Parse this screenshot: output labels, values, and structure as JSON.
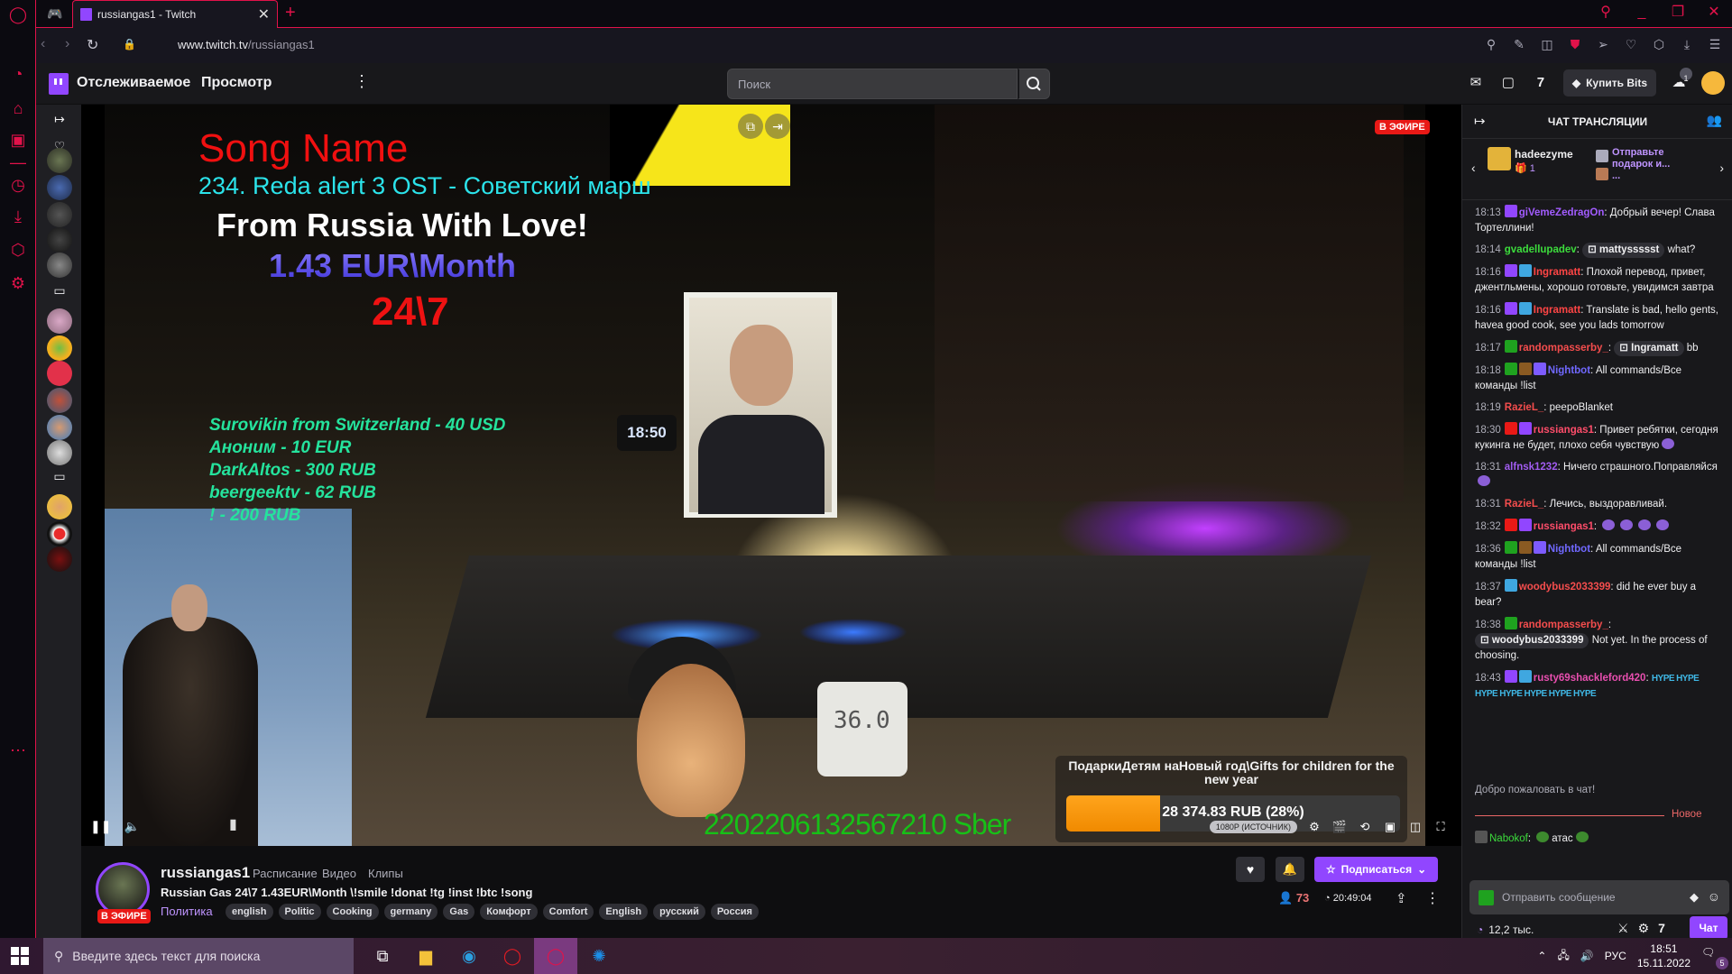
{
  "browser": {
    "tab_title": "russiangas1 - Twitch",
    "url_domain": "www.twitch.tv",
    "url_path": "/russiangas1",
    "accent": "#e2124a"
  },
  "twitch_nav": {
    "following": "Отслеживаемое",
    "browse": "Просмотр",
    "search_placeholder": "Поиск",
    "bits_button": "Купить Bits",
    "notification_count": "1",
    "brand_color": "#9146ff"
  },
  "video": {
    "live_badge": "В ЭФИРЕ",
    "overlay": {
      "song_label": "Song Name",
      "track": "234. Reda alert 3 OST - Советский марш",
      "slogan": "From Russia With Love!",
      "price": "1.43 EUR\\Month",
      "schedule": "24\\7",
      "donations": [
        "Surovikin from Switzerland - 40 USD",
        "Аноним - 10 EUR",
        "DarkAltos - 300 RUB",
        "beergeektv - 62 RUB",
        "! - 200 RUB"
      ],
      "bank": "2202206132567210 Sber",
      "clock": "18:50",
      "thermometer": "36.0"
    },
    "goal": {
      "title": "ПодаркиДетям наНовый год\\Gifts for children for the new year",
      "amount": "28 374.83 RUB (28%)",
      "progress_percent": 28
    },
    "quality": "1080P (ИСТОЧНИК)"
  },
  "channel": {
    "name": "russiangas1",
    "live_badge": "В ЭФИРЕ",
    "links": [
      "Расписание",
      "Видео",
      "Клипы"
    ],
    "title": "Russian Gas 24\\7 1.43EUR\\Month \\!smile !donat !tg !inst !btc !song",
    "category": "Политика",
    "tags": [
      "english",
      "Politic",
      "Cooking",
      "germany",
      "Gas",
      "Комфорт",
      "Comfort",
      "English",
      "русский",
      "Россия"
    ],
    "subscribe_label": "Подписаться",
    "viewers": "73",
    "uptime": "20:49:04"
  },
  "chat": {
    "header": "ЧАТ ТРАНСЛЯЦИИ",
    "gift_leader": {
      "user": "hadeezyme",
      "count": "1",
      "prompt": "Отправьте подарок и...",
      "more": "..."
    },
    "messages": [
      {
        "time": "18:13",
        "badges": [
          "#9146ff"
        ],
        "user": "giVemeZedragOn",
        "color": "#a25cff",
        "text": "Добрый вечер! Слава Тортеллини!"
      },
      {
        "time": "18:14",
        "badges": [],
        "user": "gvadellupadev",
        "color": "#3cdc3c",
        "mention": "mattyssssst",
        "text": "what?"
      },
      {
        "time": "18:16",
        "badges": [
          "#9146ff",
          "#3fa7e0"
        ],
        "user": "Ingramatt",
        "color": "#ff4545",
        "text": "Плохой перевод, привет, джентльмены, хорошо готовьте, увидимся завтра"
      },
      {
        "time": "18:16",
        "badges": [
          "#9146ff",
          "#3fa7e0"
        ],
        "user": "Ingramatt",
        "color": "#ff4545",
        "text": "Translate is bad, hello gents, havea good cook, see you lads tomorrow"
      },
      {
        "time": "18:17",
        "badges": [
          "#1fa21f"
        ],
        "user": "randompasserby_",
        "color": "#f44d4d",
        "mention": "Ingramatt",
        "text": "bb"
      },
      {
        "time": "18:18",
        "badges": [
          "#1fa21f",
          "#8a5a22",
          "#7d5bff"
        ],
        "user": "Nightbot",
        "color": "#7068ff",
        "text": "All commands/Все команды !list"
      },
      {
        "time": "18:19",
        "badges": [],
        "user": "RazieL_",
        "color": "#f44d4d",
        "text": "peepoBlanket"
      },
      {
        "time": "18:30",
        "badges": [
          "#e91916",
          "#9146ff"
        ],
        "user": "russiangas1",
        "color": "#ff4d6a",
        "text": "Привет ребятки, сегодня кукинга не будет, плохо себя чувствую",
        "emotes": 1
      },
      {
        "time": "18:31",
        "badges": [],
        "user": "alfnsk1232",
        "color": "#a15cf0",
        "text": "Ничего страшного.Поправляйся",
        "emotes": 1
      },
      {
        "time": "18:31",
        "badges": [],
        "user": "RazieL_",
        "color": "#f44d4d",
        "text": "Лечись, выздоравливай."
      },
      {
        "time": "18:32",
        "badges": [
          "#e91916",
          "#9146ff"
        ],
        "user": "russiangas1",
        "color": "#ff4d6a",
        "text": "",
        "emotes": 4
      },
      {
        "time": "18:36",
        "badges": [
          "#1fa21f",
          "#8a5a22",
          "#7d5bff"
        ],
        "user": "Nightbot",
        "color": "#7068ff",
        "text": "All commands/Все команды !list"
      },
      {
        "time": "18:37",
        "badges": [
          "#3fa7e0"
        ],
        "user": "woodybus2033399",
        "color": "#f44d4d",
        "text": "did he ever buy a bear?"
      },
      {
        "time": "18:38",
        "badges": [
          "#1fa21f"
        ],
        "user": "randompasserby_",
        "color": "#f44d4d",
        "mention": "woodybus2033399",
        "text": "Not yet. In the process of choosing."
      },
      {
        "time": "18:43",
        "badges": [
          "#9146ff",
          "#3fa7e0"
        ],
        "user": "rusty69shackleford420",
        "color": "#e94fb0",
        "text": "",
        "hype": 7
      }
    ],
    "welcome": "Добро пожаловать в чат!",
    "new_divider": "Новое",
    "latest": {
      "user": "Nabokof",
      "color": "#3cdc3c",
      "text": "атас"
    },
    "input_placeholder": "Отправить сообщение",
    "points": "12,2 тыс.",
    "send_label": "Чат"
  },
  "taskbar": {
    "search_placeholder": "Введите здесь текст для поиска",
    "language": "РУС",
    "time": "18:51",
    "date": "15.11.2022",
    "notifications": "5"
  }
}
